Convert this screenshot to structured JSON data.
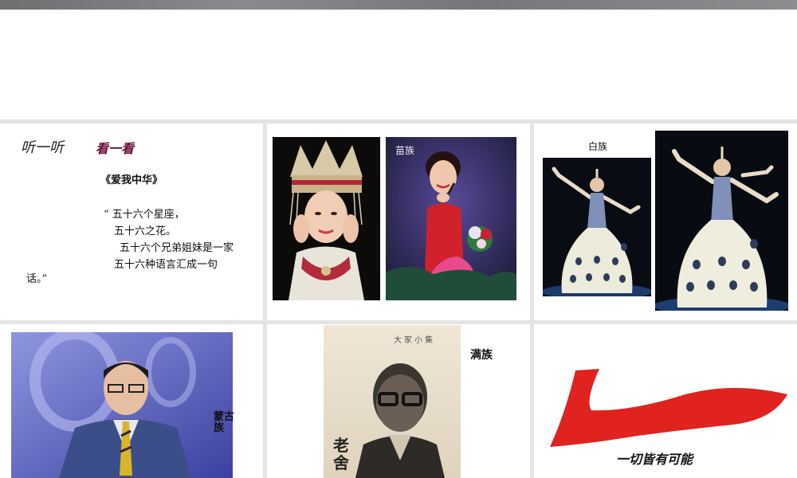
{
  "panel1": {
    "listen": "听一听",
    "look": "看一看",
    "song_title": "《爱我中华》",
    "lyrics": [
      "“ 五十六个星座，",
      "五十六之花。",
      "五十六个兄弟姐妹是一家",
      "五十六种语言汇成一句",
      "话。”"
    ]
  },
  "panel2": {
    "label": "苗族"
  },
  "panel3": {
    "label": "白族"
  },
  "panel4": {
    "label": "蒙古族"
  },
  "panel5": {
    "label": "满族",
    "book_title": "大家小集",
    "signature": "老舍"
  },
  "panel6": {
    "slogan": "一切皆有可能",
    "logo_color": "#e0231f"
  },
  "colors": {
    "background": "#e4e4e4",
    "panel": "#ffffff",
    "accent": "#6a0f3a"
  }
}
